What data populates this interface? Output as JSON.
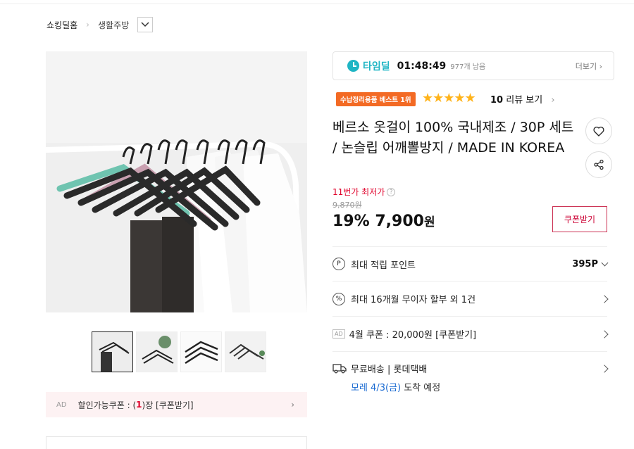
{
  "breadcrumb": {
    "home": "쇼킹딜홈",
    "category": "생활주방"
  },
  "timedeal": {
    "label": "타임딜",
    "time": "01:48:49",
    "remaining": "977개 남음",
    "more": "더보기"
  },
  "product": {
    "badge": "수납정리용품 베스트 1위",
    "stars": "★★★★★",
    "rating_stars": 5,
    "review_count": "10",
    "review_label": "리뷰 보기",
    "title": "베르소 옷걸이 100% 국내제조 / 30P 세트 / 논슬립 어깨뽈방지 / MADE IN KOREA",
    "lowest_label": "11번가 최저가",
    "original_price": "9,870원",
    "discount": "19%",
    "price": "7,900",
    "price_unit": "원",
    "coupon_button": "쿠폰받기"
  },
  "rows": {
    "points_label": "최대 적립 포인트",
    "points_value": "395P",
    "installment": "최대 16개월 무이자 할부 외 1건",
    "ad_tag": "AD",
    "coupon": "4월 쿠폰 : 20,000원 [쿠폰받기]",
    "shipping": "무료배송 | 롯데택배",
    "eta_date": "모레 4/3(금)",
    "eta_rest": " 도착 예정"
  },
  "coupon_bar": {
    "ad": "AD",
    "prefix": "할인가능쿠폰 : (",
    "count": "1",
    "suffix": ")장 [쿠폰받기]"
  },
  "colors": {
    "accent_red": "#e0002a",
    "timedeal": "#1fb5c4",
    "badge": "#f36a24",
    "star": "#ffb31a"
  }
}
